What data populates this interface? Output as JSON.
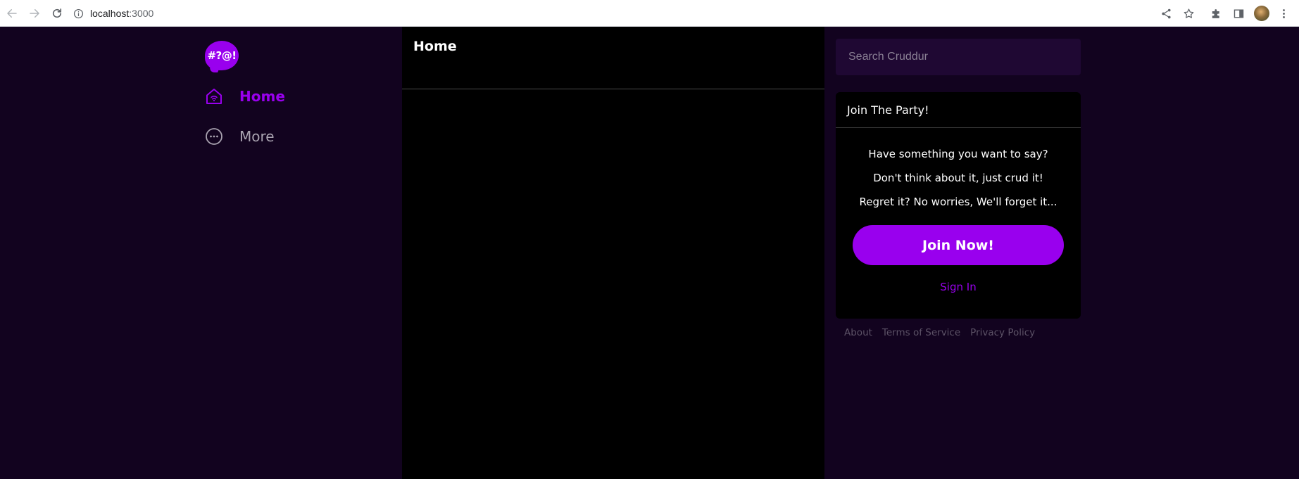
{
  "browser": {
    "url_host": "localhost",
    "url_port": ":3000"
  },
  "logo": {
    "text": "#?@!"
  },
  "sidebar": {
    "items": [
      {
        "label": "Home",
        "icon": "home-icon",
        "active": true
      },
      {
        "label": "More",
        "icon": "more-icon",
        "active": false
      }
    ]
  },
  "main": {
    "title": "Home"
  },
  "search": {
    "placeholder": "Search Cruddur"
  },
  "join_card": {
    "title": "Join The Party!",
    "lines": [
      "Have something you want to say?",
      "Don't think about it, just crud it!",
      "Regret it? No worries, We'll forget it..."
    ],
    "button_label": "Join Now!",
    "sign_in_label": "Sign In"
  },
  "footer": {
    "links": [
      "About",
      "Terms of Service",
      "Privacy Policy"
    ]
  },
  "colors": {
    "brand": "#9900ee",
    "page_bg": "#12031f",
    "panel_bg": "#000000",
    "search_bg": "#1f0833",
    "muted_text": "#5c5266"
  }
}
